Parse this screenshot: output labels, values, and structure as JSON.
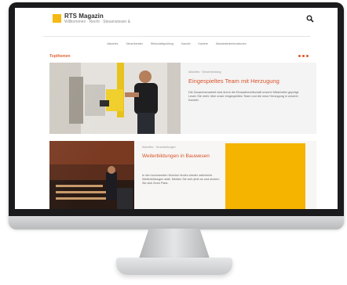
{
  "header": {
    "logo_title": "RTS Magazin",
    "logo_subtitle": "Willkommen · Recht · Steuerwissen &"
  },
  "nav": {
    "items": [
      "Aktuelles",
      "Steuerberater",
      "Wirtschaftsprüfung",
      "Kanzlei",
      "Karriere",
      "Mandanteninformationen"
    ]
  },
  "section": {
    "title": "Topthemen"
  },
  "article1": {
    "meta": "Aktuelles · Steuerberatung",
    "title": "Eingespieltes Team mit Herzugung",
    "text": "Die Zusammenarbeit wird durch die Einsatzbereitschaft unserer Mitarbeiter geprägt. Lesen Sie mehr über unser eingespieltes Team und die neue Herzugung in unserer Kanzlei."
  },
  "article2": {
    "meta": "Aktuelles · Veranstaltungen",
    "title": "Weiterbildungen in Bauwesen",
    "text": "In den kommenden Wochen finden wieder zahlreiche Weiterbildungen statt. Melden Sie sich jetzt an und sichern Sie sich Ihren Platz."
  },
  "colors": {
    "accent": "#e0582a",
    "brand_yellow": "#f4b400"
  }
}
